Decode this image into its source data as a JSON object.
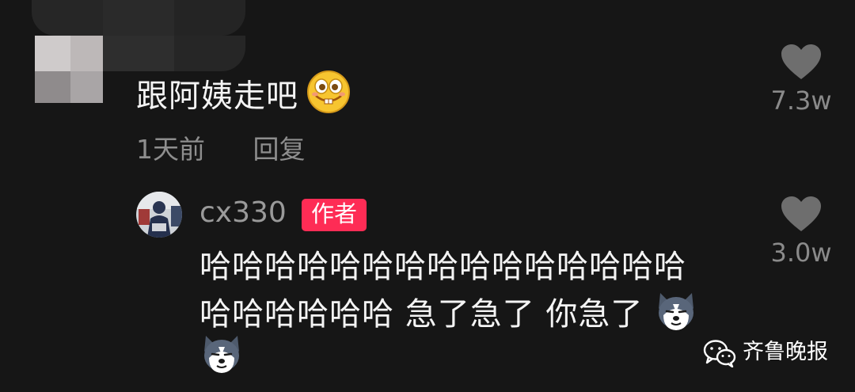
{
  "comment": {
    "text": "跟阿姨走吧",
    "emoji": "grinning-buck-tooth-emoji",
    "time": "1天前",
    "reply_label": "回复",
    "likes": "7.3w"
  },
  "reply": {
    "username": "cx330",
    "badge": "作者",
    "line1": "哈哈哈哈哈哈哈哈哈哈哈哈哈哈哈",
    "line2": "哈哈哈哈哈哈 急了急了 你急了",
    "emoji": "husky-dog-emoji",
    "likes": "3.0w"
  },
  "watermark": {
    "icon": "wechat-icon",
    "text": "齐鲁晚报"
  },
  "colors": {
    "background": "#161616",
    "badge": "#fe2c55",
    "secondary_text": "#8e8e8e",
    "heart": "#6e6e6e"
  }
}
